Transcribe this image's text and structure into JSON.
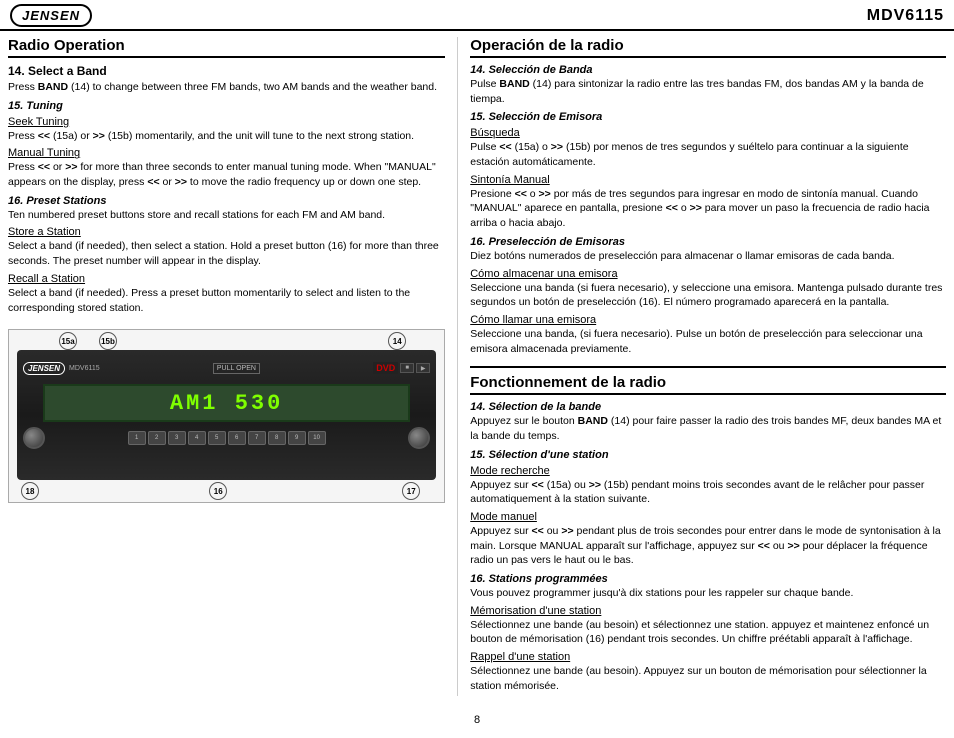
{
  "header": {
    "logo": "JENSEN",
    "model": "MDV6115"
  },
  "left_section": {
    "title": "Radio Operation",
    "items": [
      {
        "number": "14.",
        "label": "Select a Band",
        "type": "sub_title",
        "content": [
          {
            "type": "para",
            "text": "Press BAND (14) to change between three FM bands, two AM bands and the weather band.",
            "bold_words": [
              "BAND"
            ]
          }
        ]
      },
      {
        "number": "15.",
        "label": "Tuning",
        "type": "sub_title_italic",
        "content": [
          {
            "type": "underline",
            "text": "Seek Tuning"
          },
          {
            "type": "para",
            "text": "Press << (15a) or >> (15b) momentarily, and the unit will tune to the next strong station.",
            "bold_words": [
              "<<",
              ">>"
            ]
          },
          {
            "type": "underline",
            "text": "Manual Tuning"
          },
          {
            "type": "para",
            "text": "Press << or >> for more than three seconds to enter manual tuning mode. When \"MANUAL\" appears on the display, press << or >> to move the radio frequency up or down one step.",
            "bold_words": [
              "<<",
              ">>"
            ]
          }
        ]
      },
      {
        "number": "16.",
        "label": "Preset Stations",
        "type": "sub_title_italic",
        "content": [
          {
            "type": "para",
            "text": "Ten numbered preset buttons store and recall stations for each FM and AM band."
          },
          {
            "type": "underline",
            "text": "Store a Station"
          },
          {
            "type": "para",
            "text": "Select a band (if needed), then select a station. Hold a preset button (16) for more than three seconds. The preset number will appear in the display."
          },
          {
            "type": "underline",
            "text": "Recall a Station"
          },
          {
            "type": "para",
            "text": "Select a band (if needed). Press a preset button momentarily to select and listen to the corresponding stored station."
          }
        ]
      }
    ]
  },
  "device": {
    "display_text": "AM1  530",
    "model_label": "MDV6115",
    "pull_open": "PULL OPEN",
    "dvd_label": "DVD",
    "callouts": {
      "c15a": "15a",
      "c15b": "15b",
      "c14": "14",
      "c18": "18",
      "c16": "16",
      "c17": "17"
    }
  },
  "right_section": {
    "title1": "Operación de la radio",
    "items1": [
      {
        "number": "14.",
        "label": "Selección de Banda",
        "type": "sub_title_italic",
        "content": [
          {
            "type": "para",
            "text": "Pulse BAND (14) para sintonizar la radio entre las tres bandas FM, dos bandas AM y la banda de tiempa.",
            "bold_words": [
              "BAND"
            ]
          }
        ]
      },
      {
        "number": "15.",
        "label": "Selección de Emisora",
        "type": "sub_title_italic",
        "content": [
          {
            "type": "underline",
            "text": "Búsqueda"
          },
          {
            "type": "para",
            "text": "Pulse << (15a) o >> (15b) por menos de tres segundos y suéltelo para continuar a la siguiente estación automáticamente.",
            "bold_words": [
              "<<",
              ">>"
            ]
          },
          {
            "type": "underline",
            "text": "Sintonía Manual"
          },
          {
            "type": "para",
            "text": "Presione << o >> por más de tres segundos para ingresar en modo de sintonía manual. Cuando \"MANUAL\" aparece en pantalla, presione << o >> para mover un paso la frecuencia de radio hacia arriba o hacia abajo.",
            "bold_words": [
              "<<",
              ">>"
            ]
          }
        ]
      },
      {
        "number": "16.",
        "label": "Preselección de Emisoras",
        "type": "sub_title_italic",
        "content": [
          {
            "type": "para",
            "text": "Diez botóns numerados de preselección para almacenar o llamar emisoras de cada banda."
          },
          {
            "type": "underline",
            "text": "Cómo almacenar una emisora"
          },
          {
            "type": "para",
            "text": "Seleccione una banda (si fuera necesario), y seleccione una emisora. Mantenga pulsado durante tres segundos un botón de preselección (16). El número programado aparecerá en la pantalla."
          },
          {
            "type": "underline",
            "text": "Cómo llamar una emisora"
          },
          {
            "type": "para",
            "text": "Seleccione una banda, (si fuera necesario). Pulse un botón de preselección para seleccionar una emisora almacenada previamente."
          }
        ]
      }
    ],
    "title2": "Fonctionnement de la radio",
    "items2": [
      {
        "number": "14.",
        "label": "Sélection de la bande",
        "type": "sub_title_italic",
        "content": [
          {
            "type": "para",
            "text": "Appuyez sur le bouton BAND (14) pour faire passer la radio des trois bandes MF, deux bandes MA et la bande du temps.",
            "bold_words": [
              "BAND"
            ]
          }
        ]
      },
      {
        "number": "15.",
        "label": "Sélection d'une station",
        "type": "sub_title_italic",
        "content": [
          {
            "type": "underline",
            "text": "Mode recherche"
          },
          {
            "type": "para",
            "text": "Appuyez sur << (15a) ou >> (15b) pendant moins trois secondes avant de le relâcher pour passer automatiquement à la station suivante.",
            "bold_words": [
              "<<",
              ">>"
            ]
          },
          {
            "type": "underline",
            "text": "Mode manuel"
          },
          {
            "type": "para",
            "text": "Appuyez sur << ou >> pendant plus de trois secondes pour entrer dans le mode de syntonisation à la main. Lorsque MANUAL apparaît sur l'affichage, appuyez sur << ou >> pour déplacer la fréquence radio un pas vers le haut ou le bas.",
            "bold_words": [
              "<<",
              ">>"
            ]
          }
        ]
      },
      {
        "number": "16.",
        "label": "Stations programmées",
        "type": "sub_title_italic",
        "content": [
          {
            "type": "para",
            "text": "Vous pouvez programmer jusqu'à dix stations pour les rappeler sur chaque bande."
          },
          {
            "type": "underline",
            "text": "Mémorisation d'une station"
          },
          {
            "type": "para",
            "text": "Sélectionnez une bande (au besoin) et sélectionnez une station. appuyez et maintenez enfoncé un bouton de mémorisation (16) pendant trois secondes. Un chiffre préétabli apparaît à l'affichage."
          },
          {
            "type": "underline",
            "text": "Rappel d'une station"
          },
          {
            "type": "para",
            "text": "Sélectionnez une bande (au besoin). Appuyez sur un bouton de mémorisation pour sélectionner la station mémorisée."
          }
        ]
      }
    ]
  },
  "footer": {
    "page_number": "8"
  }
}
